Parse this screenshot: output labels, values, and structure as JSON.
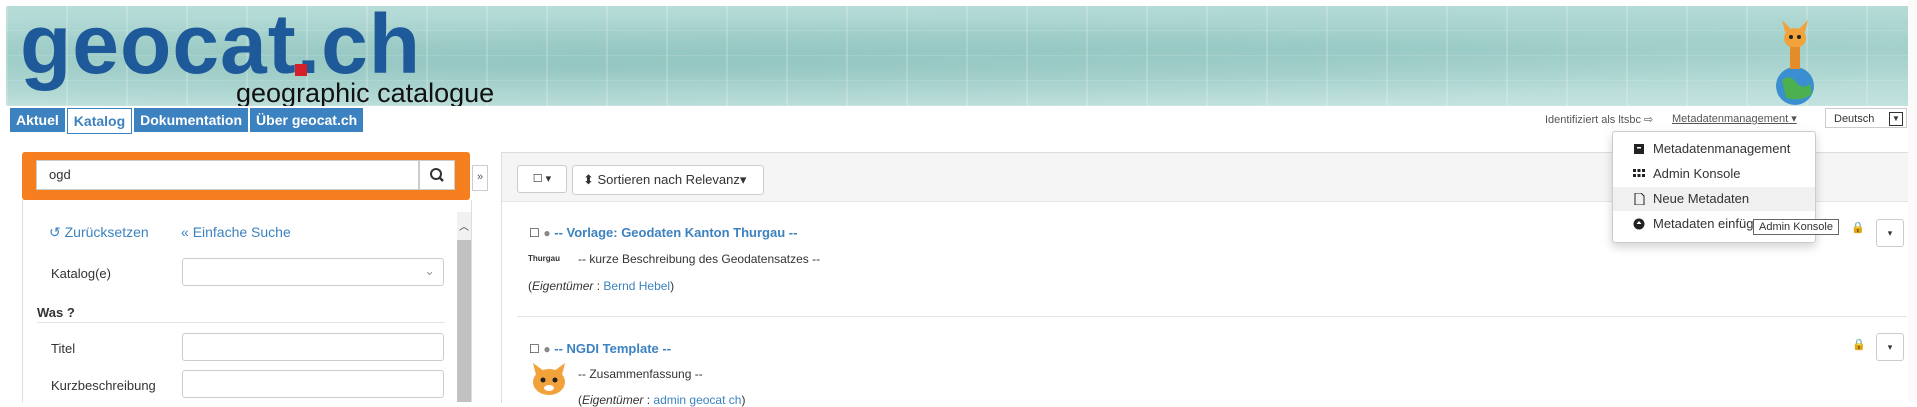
{
  "header": {
    "logo_text": "geocat.ch",
    "logo_sub": "geographic catalogue",
    "tabs": [
      "Aktuel",
      "Katalog",
      "Dokumentation",
      "Über geocat.ch"
    ],
    "identified": "Identifiziert als ltsbc",
    "mgmt": "Metadatenmanagement",
    "language": "Deutsch"
  },
  "search": {
    "value": "ogd",
    "reset": "Zurücksetzen",
    "simple": "Einfache Suche",
    "catalog_label": "Katalog(e)",
    "section": "Was ?",
    "title_label": "Titel",
    "abstract_label": "Kurzbeschreibung",
    "collapse": "»"
  },
  "results": {
    "sort_label": "Sortieren nach Relevanz",
    "records": [
      {
        "title": "-- Vorlage: Geodaten Kanton Thurgau --",
        "logo": "Thurgau",
        "desc": "-- kurze Beschreibung des Geodatensatzes --",
        "owner_label": "Eigentümer",
        "owner": "Bernd Hebel"
      },
      {
        "title": "-- NGDI Template --",
        "desc": "-- Zusammenfassung --",
        "owner_label": "Eigentümer",
        "owner": "admin geocat ch"
      }
    ]
  },
  "menu": {
    "items": [
      "Metadatenmanagement",
      "Admin Konsole",
      "Neue Metadaten",
      "Metadaten einfüg"
    ],
    "tooltip": "Admin Konsole"
  },
  "colors": {
    "brand_blue": "#3d82c0",
    "search_orange": "#f57f1f",
    "logo_red": "#d5202a"
  }
}
